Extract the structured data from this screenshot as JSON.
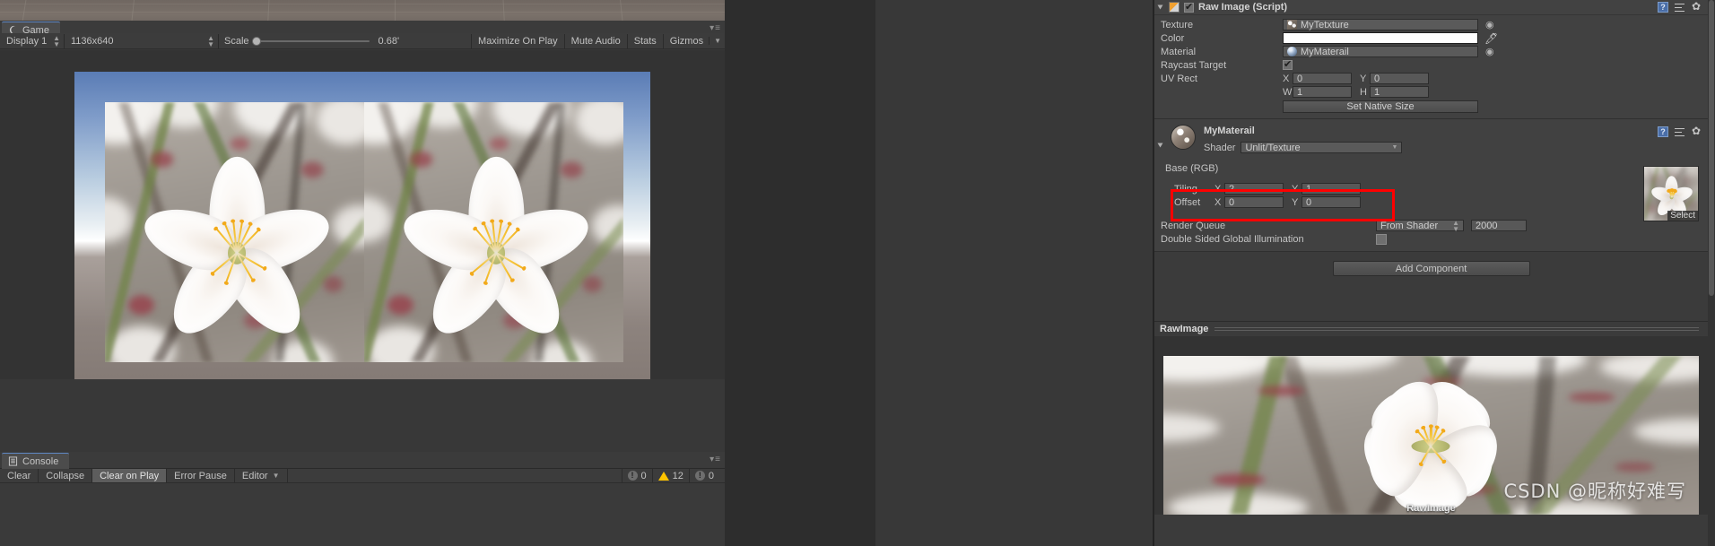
{
  "scene_strip": {
    "name": "scene-ground-plane"
  },
  "game_view": {
    "tab_label": "Game",
    "tab_icon": "game-controller-icon",
    "toolbar": {
      "display": "Display 1",
      "resolution": "1136x640",
      "scale_label": "Scale",
      "scale_value": "0.68'",
      "maximize_on_play": "Maximize On Play",
      "mute_audio": "Mute Audio",
      "stats": "Stats",
      "gizmos": "Gizmos"
    }
  },
  "console": {
    "tab_label": "Console",
    "tab_icon": "console-log-icon",
    "buttons": {
      "clear": "Clear",
      "collapse": "Collapse",
      "clear_on_play": "Clear on Play",
      "error_pause": "Error Pause",
      "editor": "Editor"
    },
    "counts": {
      "info": "0",
      "warning": "12",
      "error": "0"
    }
  },
  "inspector": {
    "raw_image": {
      "title": "Raw Image (Script)",
      "enabled": true,
      "fields": {
        "texture_label": "Texture",
        "texture_value": "MyTetxture",
        "color_label": "Color",
        "color_value": "#FFFFFF",
        "material_label": "Material",
        "material_value": "MyMaterail",
        "raycast_label": "Raycast Target",
        "raycast_checked": true,
        "uv_rect_label": "UV Rect",
        "uv_x_axis": "X",
        "uv_x": "0",
        "uv_y_axis": "Y",
        "uv_y": "0",
        "uv_w_axis": "W",
        "uv_w": "1",
        "uv_h_axis": "H",
        "uv_h": "1",
        "set_native_size": "Set Native Size"
      }
    },
    "material": {
      "name": "MyMaterail",
      "shader_label": "Shader",
      "shader_value": "Unlit/Texture",
      "base_rgb_label": "Base (RGB)",
      "select_label": "Select",
      "tiling_label": "Tiling",
      "tiling_x_axis": "X",
      "tiling_x": "2",
      "tiling_y_axis": "Y",
      "tiling_y": "1",
      "offset_label": "Offset",
      "offset_x_axis": "X",
      "offset_x": "0",
      "offset_y_axis": "Y",
      "offset_y": "0",
      "highlight_color": "#FF0000",
      "render_queue_label": "Render Queue",
      "render_queue_mode": "From Shader",
      "render_queue_value": "2000",
      "double_sided_label": "Double Sided Global Illumination",
      "double_sided_checked": false
    },
    "add_component": "Add Component",
    "preview": {
      "title": "RawImage",
      "caption": "RawImage",
      "watermark": "CSDN @昵称好难写"
    }
  }
}
